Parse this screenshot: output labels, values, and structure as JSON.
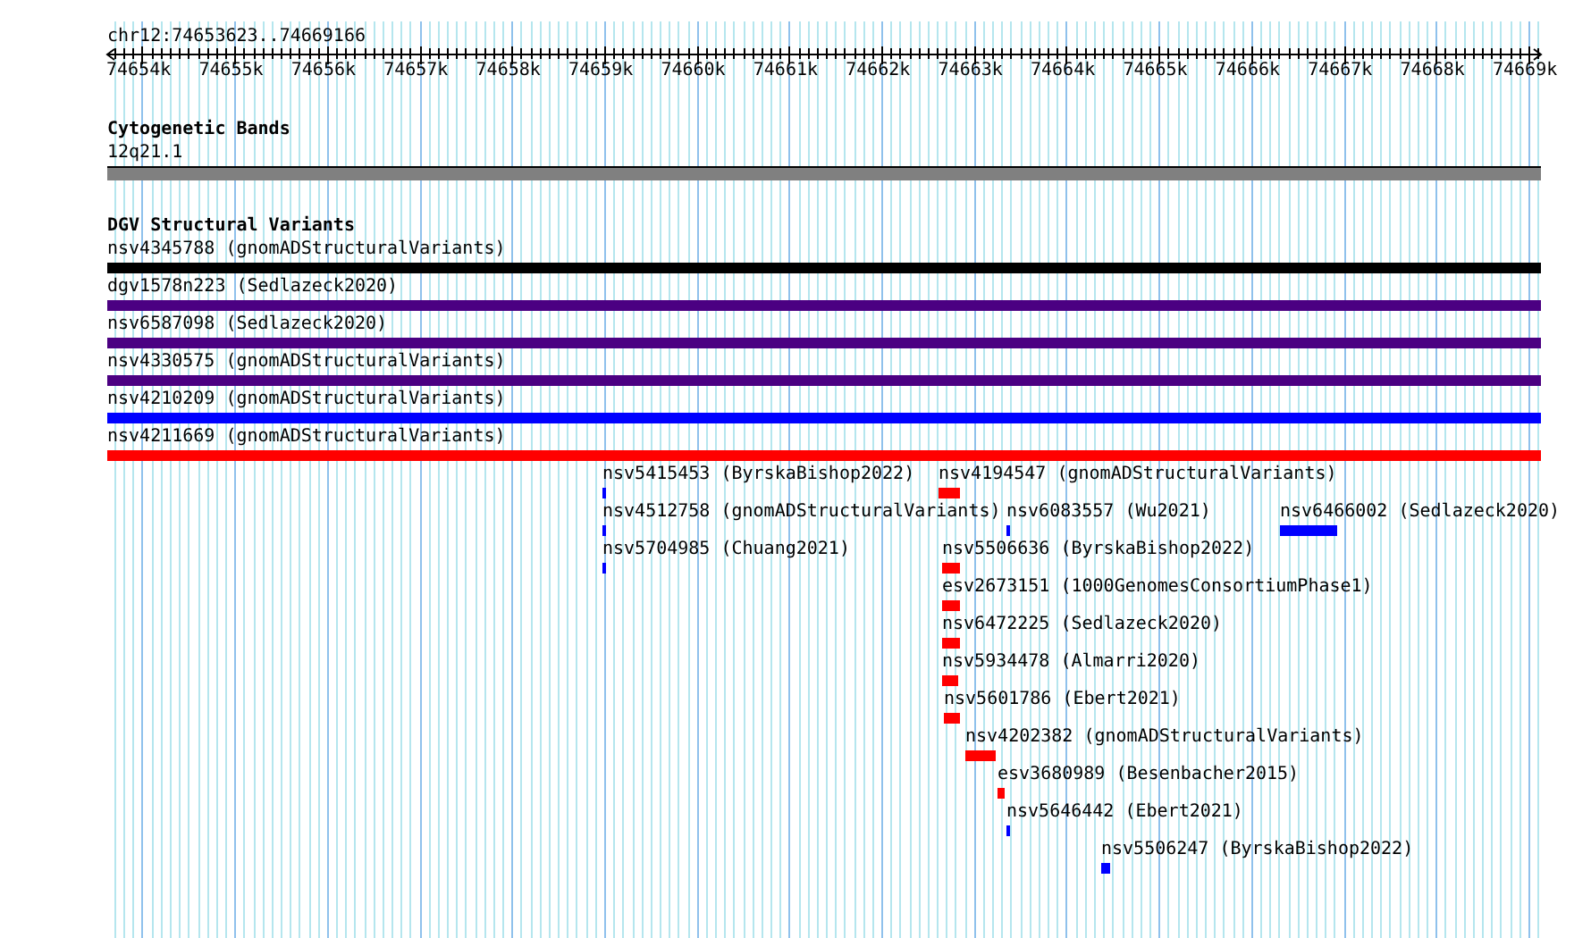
{
  "ruler": {
    "location": "chr12:74653623..74669166",
    "ticks": [
      "74654k",
      "74655k",
      "74656k",
      "74657k",
      "74658k",
      "74659k",
      "74660k",
      "74661k",
      "74662k",
      "74663k",
      "74664k",
      "74665k",
      "74666k",
      "74667k",
      "74668k",
      "74669k"
    ]
  },
  "cytoband_track": {
    "title": "Cytogenetic Bands",
    "band": {
      "label": "12q21.1",
      "color": "#808080"
    }
  },
  "variant_track": {
    "title": "DGV Structural Variants",
    "features": [
      {
        "label": "nsv4345788 (gnomADStructuralVariants)",
        "color": "#000000"
      },
      {
        "label": "dgv1578n223 (Sedlazeck2020)",
        "color": "#4b0082"
      },
      {
        "label": "nsv6587098 (Sedlazeck2020)",
        "color": "#4b0082"
      },
      {
        "label": "nsv4330575 (gnomADStructuralVariants)",
        "color": "#4b0082"
      },
      {
        "label": "nsv4210209 (gnomADStructuralVariants)",
        "color": "#0000ff"
      },
      {
        "label": "nsv4211669 (gnomADStructuralVariants)",
        "color": "#ff0000"
      },
      {
        "label": "nsv5415453 (ByrskaBishop2022)",
        "color": "#0000ff"
      },
      {
        "label": "nsv4194547 (gnomADStructuralVariants)",
        "color": "#ff0000"
      },
      {
        "label": "nsv4512758 (gnomADStructuralVariants)",
        "color": "#0000ff"
      },
      {
        "label": "nsv6083557 (Wu2021)",
        "color": "#0000ff"
      },
      {
        "label": "nsv6466002 (Sedlazeck2020)",
        "color": "#0000ff"
      },
      {
        "label": "nsv5704985 (Chuang2021)",
        "color": "#0000ff"
      },
      {
        "label": "nsv5506636 (ByrskaBishop2022)",
        "color": "#ff0000"
      },
      {
        "label": "esv2673151 (1000GenomesConsortiumPhase1)",
        "color": "#ff0000"
      },
      {
        "label": "nsv6472225 (Sedlazeck2020)",
        "color": "#ff0000"
      },
      {
        "label": "nsv5934478 (Almarri2020)",
        "color": "#ff0000"
      },
      {
        "label": "nsv5601786 (Ebert2021)",
        "color": "#ff0000"
      },
      {
        "label": "nsv4202382 (gnomADStructuralVariants)",
        "color": "#ff0000"
      },
      {
        "label": "esv3680989 (Besenbacher2015)",
        "color": "#ff0000"
      },
      {
        "label": "nsv5646442 (Ebert2021)",
        "color": "#0000ff"
      },
      {
        "label": "nsv5506247 (ByrskaBishop2022)",
        "color": "#0000ff"
      }
    ]
  }
}
